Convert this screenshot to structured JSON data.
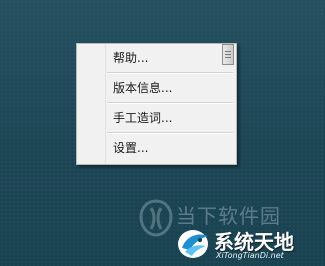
{
  "menu": {
    "items": [
      {
        "label": "帮助..."
      },
      {
        "label": "版本信息..."
      },
      {
        "label": "手工造词..."
      },
      {
        "label": "设置..."
      }
    ]
  },
  "watermark": {
    "tray_text": "当下软件园",
    "site_name": "系统天地",
    "site_url": "XiTongTianDi.net"
  }
}
